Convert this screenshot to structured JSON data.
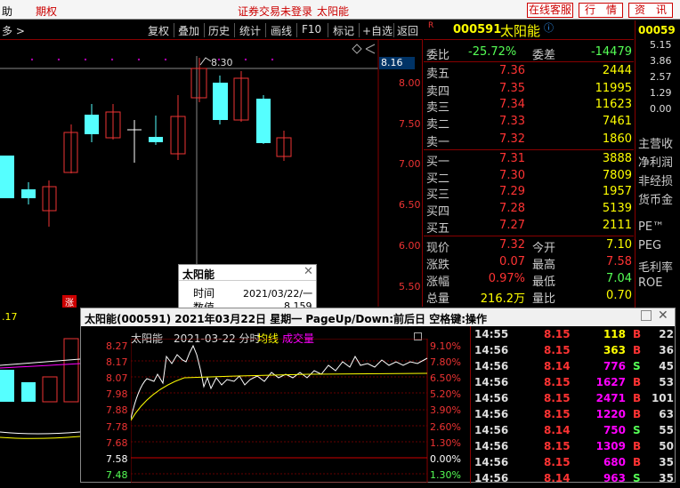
{
  "topbar": {
    "left_label": "助",
    "tab": "期权",
    "status": "证券交易未登录",
    "stock_title": "太阳能",
    "service_btn": "在线客服",
    "quote_btn": "行　情",
    "info_btn": "资　讯"
  },
  "toolbar": {
    "more": "多 >",
    "items": [
      "复权",
      "叠加",
      "历史",
      "统计",
      "画线",
      "F10",
      "标记",
      "+自选",
      "返回"
    ]
  },
  "kline": {
    "peak_label": "8.30",
    "current_price": "8.16",
    "y_ticks": [
      "8.00",
      "7.50",
      "7.00",
      "6.50",
      "6.00",
      "5.50"
    ],
    "vol_label": ".17",
    "rise_tag": "涨"
  },
  "popup": {
    "title": "太阳能",
    "time_label": "时间",
    "time_value": "2021/03/22/一",
    "value_label": "数值",
    "value_value": "8.159"
  },
  "quote": {
    "code": "000591",
    "name": "太阳能",
    "weibi_label": "委比",
    "weibi_value": "-25.72%",
    "weicha_label": "委差",
    "weicha_value": "-14479",
    "asks": [
      {
        "label": "卖五",
        "price": "7.36",
        "vol": "2444"
      },
      {
        "label": "卖四",
        "price": "7.35",
        "vol": "11995"
      },
      {
        "label": "卖三",
        "price": "7.34",
        "vol": "11623"
      },
      {
        "label": "卖二",
        "price": "7.33",
        "vol": "7461"
      },
      {
        "label": "卖一",
        "price": "7.32",
        "vol": "1860"
      }
    ],
    "bids": [
      {
        "label": "买一",
        "price": "7.31",
        "vol": "3888"
      },
      {
        "label": "买二",
        "price": "7.30",
        "vol": "7809"
      },
      {
        "label": "买三",
        "price": "7.29",
        "vol": "1957"
      },
      {
        "label": "买四",
        "price": "7.28",
        "vol": "5139"
      },
      {
        "label": "买五",
        "price": "7.27",
        "vol": "2111"
      }
    ],
    "stats": [
      {
        "l1": "现价",
        "v1": "7.32",
        "l2": "今开",
        "v2": "7.10"
      },
      {
        "l1": "涨跌",
        "v1": "0.07",
        "l2": "最高",
        "v2": "7.58"
      },
      {
        "l1": "涨幅",
        "v1": "0.97%",
        "l2": "最低",
        "v2": "7.04"
      },
      {
        "l1": "总量",
        "v1": "216.2万",
        "l2": "量比",
        "v2": "0.70"
      }
    ]
  },
  "side": {
    "code": "00059",
    "values": [
      "5.15",
      "3.86",
      "2.57",
      "1.29",
      "0.00"
    ],
    "labels": [
      "主营收",
      "净利润",
      "非经损",
      "货币金",
      "PE™",
      "PEG",
      "毛利率",
      "ROE"
    ]
  },
  "intraday": {
    "title": "太阳能(000591) 2021年03月22日 星期一 PageUp/Down:前后日 空格键:操作",
    "name": "太阳能",
    "date": "2021-03-22 分时",
    "avg_label": "均线",
    "vol_label": "成交量",
    "left_ticks": [
      "8.27",
      "8.17",
      "8.07",
      "7.98",
      "7.88",
      "7.78",
      "7.68",
      "7.58",
      "7.48"
    ],
    "right_ticks": [
      "9.10%",
      "7.80%",
      "6.50%",
      "5.20%",
      "3.90%",
      "2.60%",
      "1.30%",
      "0.00%",
      "1.30%"
    ],
    "ticks": [
      {
        "time": "14:55",
        "price": "8.15",
        "vol": "118",
        "side": "B",
        "count": "22"
      },
      {
        "time": "14:56",
        "price": "8.15",
        "vol": "363",
        "side": "B",
        "count": "36"
      },
      {
        "time": "14:56",
        "price": "8.14",
        "vol": "776",
        "side": "S",
        "count": "45"
      },
      {
        "time": "14:56",
        "price": "8.15",
        "vol": "1627",
        "side": "B",
        "count": "53"
      },
      {
        "time": "14:56",
        "price": "8.15",
        "vol": "2471",
        "side": "B",
        "count": "101"
      },
      {
        "time": "14:56",
        "price": "8.15",
        "vol": "1220",
        "side": "B",
        "count": "63"
      },
      {
        "time": "14:56",
        "price": "8.14",
        "vol": "750",
        "side": "S",
        "count": "55"
      },
      {
        "time": "14:56",
        "price": "8.15",
        "vol": "1309",
        "side": "B",
        "count": "50"
      },
      {
        "time": "14:56",
        "price": "8.15",
        "vol": "680",
        "side": "B",
        "count": "35"
      },
      {
        "time": "14:56",
        "price": "8.14",
        "vol": "963",
        "side": "S",
        "count": "35"
      }
    ]
  }
}
